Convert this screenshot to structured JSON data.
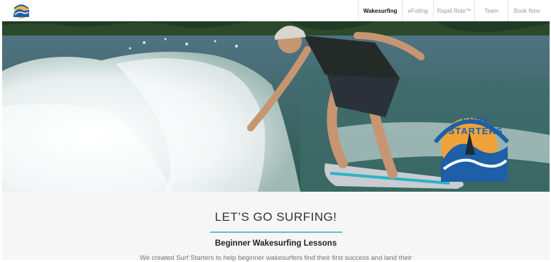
{
  "brand": {
    "logo_name": "surf-starters-logo",
    "hero_logo_text": "SURF STARTERS"
  },
  "nav": {
    "items": [
      {
        "label": "Wakesurfing",
        "active": true
      },
      {
        "label": "eFoiling",
        "active": false
      },
      {
        "label": "Rapid Ride™",
        "active": false
      },
      {
        "label": "Team",
        "active": false
      },
      {
        "label": "Book Now",
        "active": false
      }
    ]
  },
  "hero": {
    "image_name": "wakesurfer-riding-wave-photo"
  },
  "main": {
    "title": "LET’S GO SURFING!",
    "subtitle": "Beginner Wakesurfing Lessons",
    "paragraph": "We created Surf Starters to help beginner wakesurfers find their first success and land their"
  },
  "colors": {
    "accent": "#5fc2c6",
    "logo_blue": "#1d5fa8",
    "logo_orange": "#f0a23a"
  }
}
